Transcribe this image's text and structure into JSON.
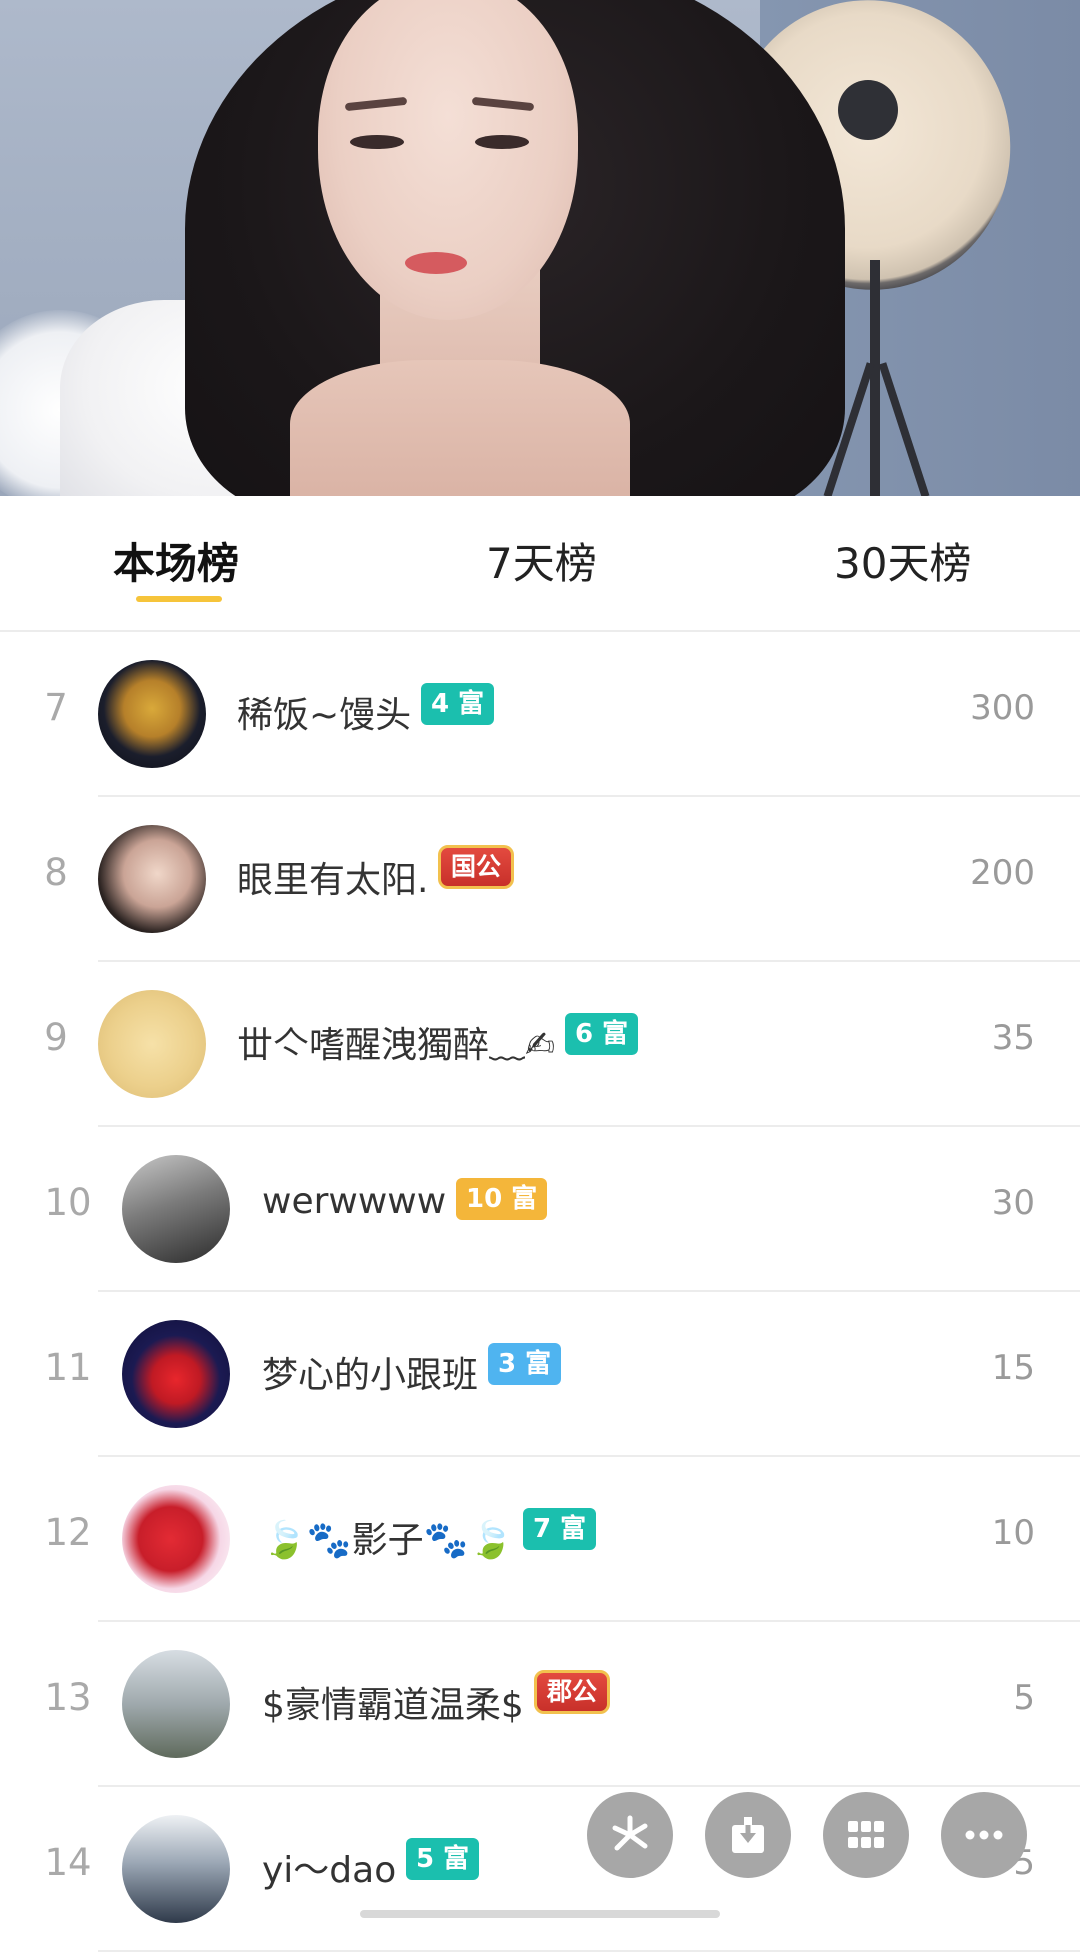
{
  "tabs": [
    {
      "label": "本场榜",
      "active": true
    },
    {
      "label": "7天榜",
      "active": false
    },
    {
      "label": "30天榜",
      "active": false
    }
  ],
  "rows": [
    {
      "rank": "7",
      "name": "稀饭~馒头",
      "badge": "4 富",
      "badge_color": "#1bbfae",
      "score": "300"
    },
    {
      "rank": "8",
      "name": "眼里有太阳.",
      "badge": "国公",
      "badge_color": "#d8382f",
      "score": "200"
    },
    {
      "rank": "9",
      "name": "丗亽嗜醒洩獨醉﹏✍",
      "badge": "6 富",
      "badge_color": "#1bbfae",
      "score": "35"
    },
    {
      "rank": "10",
      "name": "werwwww",
      "badge": "10 富",
      "badge_color": "#f4b63a",
      "score": "30"
    },
    {
      "rank": "11",
      "name": "梦心的小跟班",
      "badge": "3 富",
      "badge_color": "#4fb4f0",
      "score": "15"
    },
    {
      "rank": "12",
      "name": "🍃🐾影子🐾🍃",
      "badge": "7 富",
      "badge_color": "#1bbfae",
      "score": "10"
    },
    {
      "rank": "13",
      "name": "$豪情霸道温柔$",
      "badge": "郡公",
      "badge_color": "#d8382f",
      "score": "5"
    },
    {
      "rank": "14",
      "name": "yi～dao",
      "badge": "5 富",
      "badge_color": "#1bbfae",
      "score": "5"
    }
  ],
  "fab_icons": [
    "kuaishou-icon",
    "download-icon",
    "grid-icon",
    "more-icon"
  ],
  "colors": {
    "tab_underline": "#f6c43a",
    "fab": "#a7a7a7"
  }
}
